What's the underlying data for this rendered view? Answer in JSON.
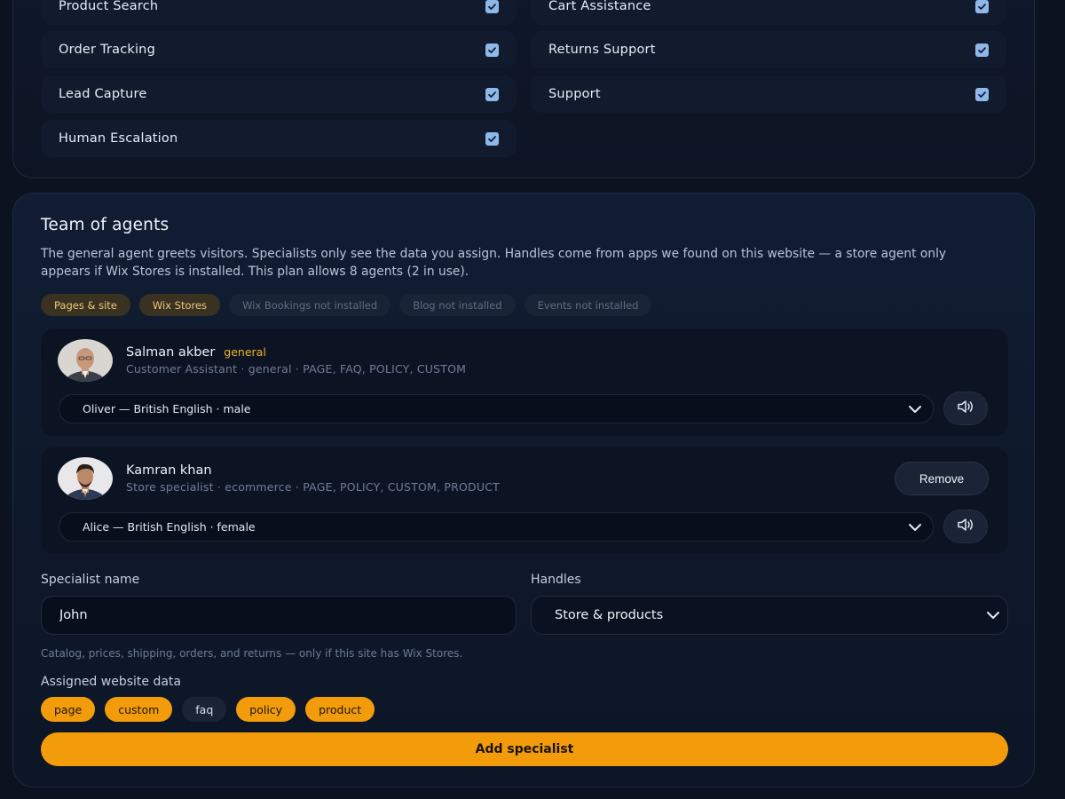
{
  "capabilities": [
    {
      "label": "Product Search",
      "checked": true
    },
    {
      "label": "Cart Assistance",
      "checked": true
    },
    {
      "label": "Order Tracking",
      "checked": true
    },
    {
      "label": "Returns Support",
      "checked": true
    },
    {
      "label": "Lead Capture",
      "checked": true
    },
    {
      "label": "Support",
      "checked": true
    },
    {
      "label": "Human Escalation",
      "checked": true
    }
  ],
  "team": {
    "title": "Team of agents",
    "description": "The general agent greets visitors. Specialists only see the data you assign. Handles come from apps we found on this website — a store agent only appears if Wix Stores is installed. This plan allows 8 agents (2 in use).",
    "sources": [
      {
        "label": "Pages & site",
        "state": "active"
      },
      {
        "label": "Wix Stores",
        "state": "active"
      },
      {
        "label": "Wix Bookings not installed",
        "state": "inactive"
      },
      {
        "label": "Blog not installed",
        "state": "inactive"
      },
      {
        "label": "Events not installed",
        "state": "inactive"
      }
    ],
    "agents": [
      {
        "name": "Salman akber",
        "badge": "general",
        "meta": "Customer Assistant · general · PAGE, FAQ, POLICY, CUSTOM",
        "voice": "Oliver — British English · male"
      },
      {
        "name": "Kamran khan",
        "badge": "",
        "meta": "Store specialist · ecommerce · PAGE, POLICY, CUSTOM, PRODUCT",
        "voice": "Alice — British English · female",
        "remove_label": "Remove"
      }
    ],
    "form": {
      "name_label": "Specialist name",
      "name_value": "John",
      "handles_label": "Handles",
      "handles_value": "Store & products",
      "handles_hint": "Catalog, prices, shipping, orders, and returns — only if this site has Wix Stores.",
      "assigned_label": "Assigned website data",
      "assigned": [
        {
          "label": "page",
          "selected": true
        },
        {
          "label": "custom",
          "selected": true
        },
        {
          "label": "faq",
          "selected": false
        },
        {
          "label": "policy",
          "selected": true
        },
        {
          "label": "product",
          "selected": true
        }
      ],
      "add_label": "Add specialist"
    }
  },
  "colors": {
    "accent": "#f39c0b",
    "badge": "#f0b429",
    "checkbox": "#8fb8ea"
  },
  "icons": [
    "checkbox-checked-icon",
    "chevron-down-icon",
    "speaker-icon"
  ]
}
